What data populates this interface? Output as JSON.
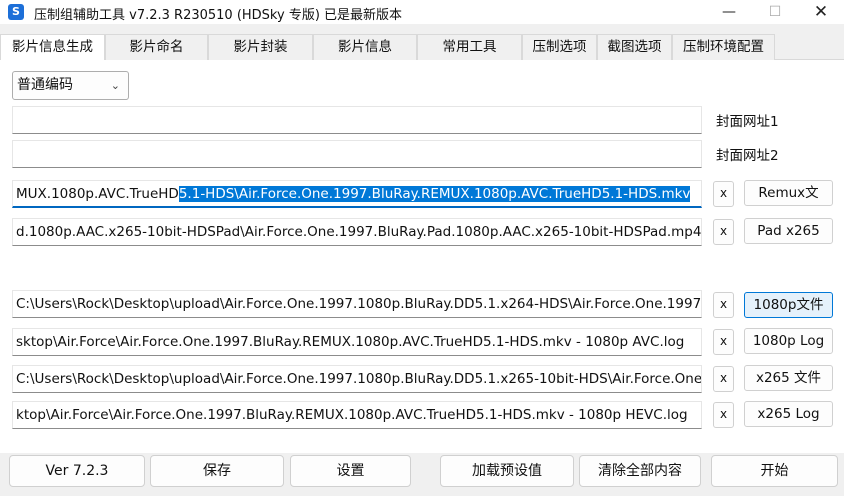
{
  "window": {
    "title": "压制组辅助工具 v7.2.3 R230510 (HDSky 专版)    已是最新版本",
    "minimize_glyph": "—",
    "maximize_glyph": "☐",
    "close_glyph": "✕"
  },
  "tabs": [
    {
      "label": "影片信息生成",
      "active": true
    },
    {
      "label": "影片命名"
    },
    {
      "label": "影片封装"
    },
    {
      "label": "影片信息"
    },
    {
      "label": "常用工具"
    },
    {
      "label": "压制选项"
    },
    {
      "label": "截图选项"
    },
    {
      "label": "压制环境配置"
    }
  ],
  "encoding_combo": {
    "value": "普通编码"
  },
  "cover_urls": [
    {
      "value": "",
      "label": "封面网址1"
    },
    {
      "value": "",
      "label": "封面网址2"
    }
  ],
  "remux_row": {
    "value_prefix": "MUX.1080p.AVC.TrueHD",
    "value_selected": "5.1-HDS\\Air.Force.One.1997.BluRay.REMUX.1080p.AVC.TrueHD5.1-HDS.mkv",
    "clear_label": "x",
    "button_label": "Remux文"
  },
  "pad_row": {
    "value": "d.1080p.AAC.x265-10bit-HDSPad\\Air.Force.One.1997.BluRay.Pad.1080p.AAC.x265-10bit-HDSPad.mp4",
    "clear_label": "x",
    "button_label": "Pad x265"
  },
  "file_rows": [
    {
      "value": "C:\\Users\\Rock\\Desktop\\upload\\Air.Force.One.1997.1080p.BluRay.DD5.1.x264-HDS\\Air.Force.One.1997",
      "clear_label": "x",
      "button_label": "1080p文件"
    },
    {
      "value": "sktop\\Air.Force\\Air.Force.One.1997.BluRay.REMUX.1080p.AVC.TrueHD5.1-HDS.mkv - 1080p AVC.log",
      "clear_label": "x",
      "button_label": "1080p Log"
    },
    {
      "value": "C:\\Users\\Rock\\Desktop\\upload\\Air.Force.One.1997.1080p.BluRay.DD5.1.x265-10bit-HDS\\Air.Force.One",
      "clear_label": "x",
      "button_label": "x265 文件"
    },
    {
      "value": "ktop\\Air.Force\\Air.Force.One.1997.BluRay.REMUX.1080p.AVC.TrueHD5.1-HDS.mkv - 1080p HEVC.log",
      "clear_label": "x",
      "button_label": "x265 Log"
    }
  ],
  "footer": {
    "version": "Ver 7.2.3",
    "save": "保存",
    "settings": "设置",
    "load_presets": "加载预设值",
    "clear_all": "清除全部内容",
    "start": "开始"
  }
}
